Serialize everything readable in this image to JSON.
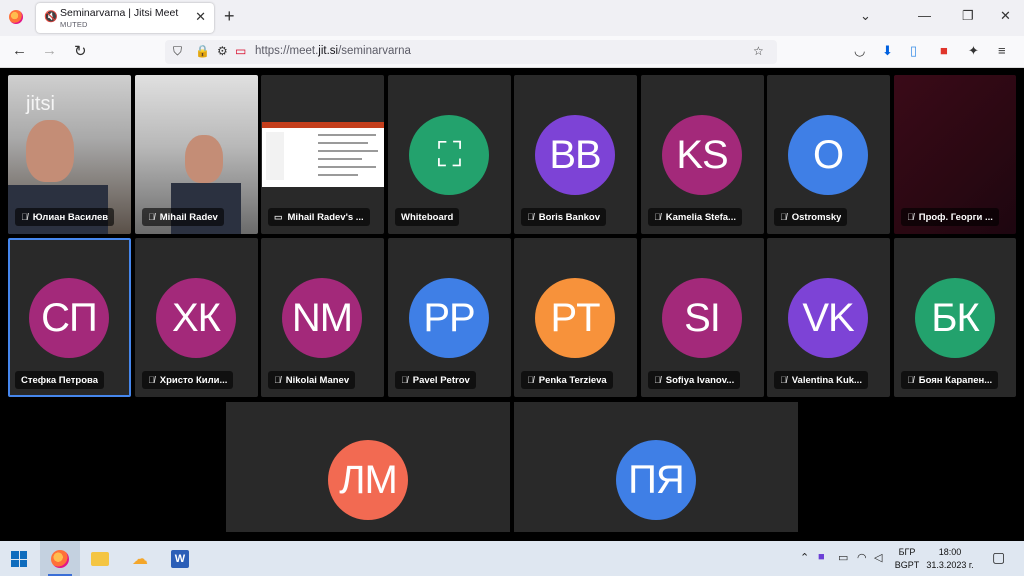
{
  "browser": {
    "tab_title": "Seminarvarna | Jitsi Meet",
    "tab_subtitle": "MUTED",
    "url_prefix": "https://meet.",
    "url_domain": "jit.si",
    "url_path": "/seminarvarna"
  },
  "meeting": {
    "watermark": "jitsi",
    "tiles": [
      {
        "label": "Юлиан Василев",
        "type": "video",
        "muted": true
      },
      {
        "label": "Mihail Radev",
        "type": "video",
        "muted": true
      },
      {
        "label": "Mihail Radev's ...",
        "type": "screenshare",
        "muted": false
      },
      {
        "label": "Whiteboard",
        "type": "whiteboard",
        "muted": false,
        "color": "#23a26d"
      },
      {
        "label": "Boris Bankov",
        "initials": "BB",
        "color": "#7d43d6",
        "muted": true
      },
      {
        "label": "Kamelia Stefa...",
        "initials": "KS",
        "color": "#a3297a",
        "muted": true
      },
      {
        "label": "Ostromsky",
        "initials": "O",
        "color": "#3f7fe6",
        "muted": true
      },
      {
        "label": "Проф. Георги ...",
        "type": "camera-off",
        "muted": true
      },
      {
        "label": "Стефка Петрова",
        "initials": "СП",
        "color": "#a3297a",
        "muted": false,
        "active": true
      },
      {
        "label": "Христо Кили...",
        "initials": "ХК",
        "color": "#a3297a",
        "muted": true
      },
      {
        "label": "Nikolai Manev",
        "initials": "NM",
        "color": "#a3297a",
        "muted": true
      },
      {
        "label": "Pavel Petrov",
        "initials": "PP",
        "color": "#3f7fe6",
        "muted": true
      },
      {
        "label": "Penka Terzieva",
        "initials": "PT",
        "color": "#f7923b",
        "muted": true
      },
      {
        "label": "Sofiya Ivanov...",
        "initials": "SI",
        "color": "#a3297a",
        "muted": true
      },
      {
        "label": "Valentina Kuk...",
        "initials": "VK",
        "color": "#7d43d6",
        "muted": true
      },
      {
        "label": "Боян Карапен...",
        "initials": "БК",
        "color": "#23a26d",
        "muted": true
      }
    ],
    "bottom_tiles": [
      {
        "initials": "ЛМ",
        "color": "#f26a52"
      },
      {
        "initials": "ПЯ",
        "color": "#3f7fe6"
      }
    ]
  },
  "taskbar": {
    "lang_top": "БГР",
    "lang_bottom": "BGPT",
    "time": "18:00",
    "date": "31.3.2023 г."
  }
}
